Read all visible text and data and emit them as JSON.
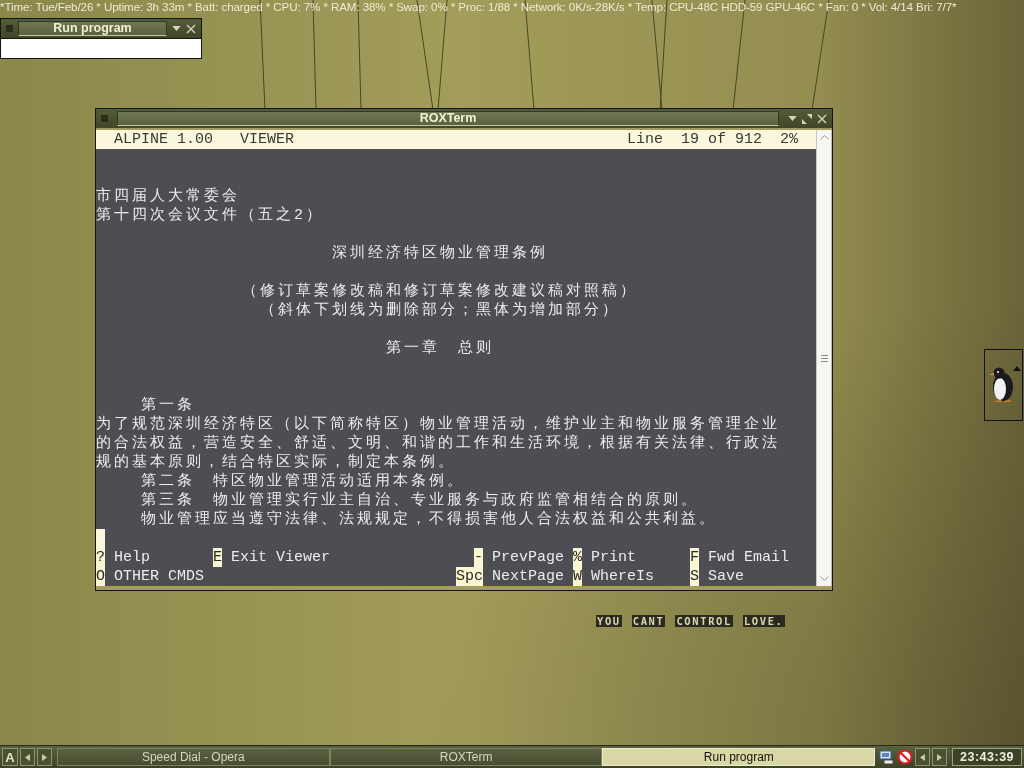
{
  "status_bar": {
    "text": "*Time: Tue/Feb/26 * Uptime: 3h 33m * Batt: charged * CPU: 7% * RAM: 38% * Swap: 0% * Proc: 1/88 * Network: 0K/s-28K/s * Temp: CPU-48C HDD-59 GPU-46C * Fan: 0 * Vol: 4/14 Bri: 7/7*"
  },
  "run_dialog": {
    "title": "Run program"
  },
  "terminal_window": {
    "title": "ROXTerm",
    "header": {
      "app": "ALPINE 1.00",
      "mode": "VIEWER",
      "position_label": "Line",
      "position": "19 of 912",
      "percent": "2%"
    },
    "lines": [
      {
        "kind": "blank"
      },
      {
        "kind": "blank"
      },
      {
        "kind": "text",
        "text": "市四届人大常委会",
        "centered": false,
        "indent": false
      },
      {
        "kind": "text",
        "text": "第十四次会议文件（五之2）",
        "centered": false,
        "indent": false
      },
      {
        "kind": "blank"
      },
      {
        "kind": "text",
        "text": "深圳经济特区物业管理条例",
        "centered": true,
        "indent": false
      },
      {
        "kind": "blank"
      },
      {
        "kind": "text",
        "text": "（修订草案修改稿和修订草案修改建议稿对照稿）",
        "centered": true,
        "indent": false
      },
      {
        "kind": "text",
        "text": "（斜体下划线为删除部分；黑体为增加部分）",
        "centered": true,
        "indent": false
      },
      {
        "kind": "blank"
      },
      {
        "kind": "text",
        "text": "第一章　总则",
        "centered": true,
        "indent": false
      },
      {
        "kind": "blank"
      },
      {
        "kind": "blank"
      },
      {
        "kind": "text",
        "text": "第一条",
        "centered": false,
        "indent": true
      },
      {
        "kind": "text",
        "text": "为了规范深圳经济特区（以下简称特区）物业管理活动，维护业主和物业服务管理企业",
        "centered": false,
        "indent": false
      },
      {
        "kind": "text",
        "text": "的合法权益，营造安全、舒适、文明、和谐的工作和生活环境，根据有关法律、行政法",
        "centered": false,
        "indent": false
      },
      {
        "kind": "text",
        "text": "规的基本原则，结合特区实际，制定本条例。",
        "centered": false,
        "indent": false
      },
      {
        "kind": "text",
        "text": "第二条　特区物业管理活动适用本条例。",
        "centered": false,
        "indent": true
      },
      {
        "kind": "text",
        "text": "第三条　物业管理实行业主自治、专业服务与政府监管相结合的原则。",
        "centered": false,
        "indent": true
      },
      {
        "kind": "text",
        "text": "物业管理应当遵守法律、法规规定，不得损害他人合法权益和公共利益。",
        "centered": false,
        "indent": true
      },
      {
        "kind": "cursor"
      }
    ],
    "menu": {
      "left": [
        [
          {
            "key": "?",
            "label": "Help"
          },
          {
            "key": "E",
            "label": "Exit Viewer"
          }
        ],
        [
          {
            "key": "O",
            "label": "OTHER CMDS"
          }
        ]
      ],
      "right": [
        [
          {
            "key": "-",
            "label": "PrevPage"
          },
          {
            "key": "%",
            "label": "Print"
          },
          {
            "key": "F",
            "label": "Fwd Email"
          }
        ],
        [
          {
            "key": "Spc",
            "label": "NextPage"
          },
          {
            "key": "W",
            "label": "WhereIs"
          },
          {
            "key": "S",
            "label": "Save"
          }
        ]
      ]
    }
  },
  "desktop": {
    "slogan": "YOU CANT CONTROL LOVE."
  },
  "taskbar": {
    "start_label": "A",
    "tasks": [
      {
        "label": "Speed Dial - Opera",
        "selected": false
      },
      {
        "label": "ROXTerm",
        "selected": false
      },
      {
        "label": "Run program",
        "selected": true
      }
    ],
    "clock": "23:43:39"
  }
}
